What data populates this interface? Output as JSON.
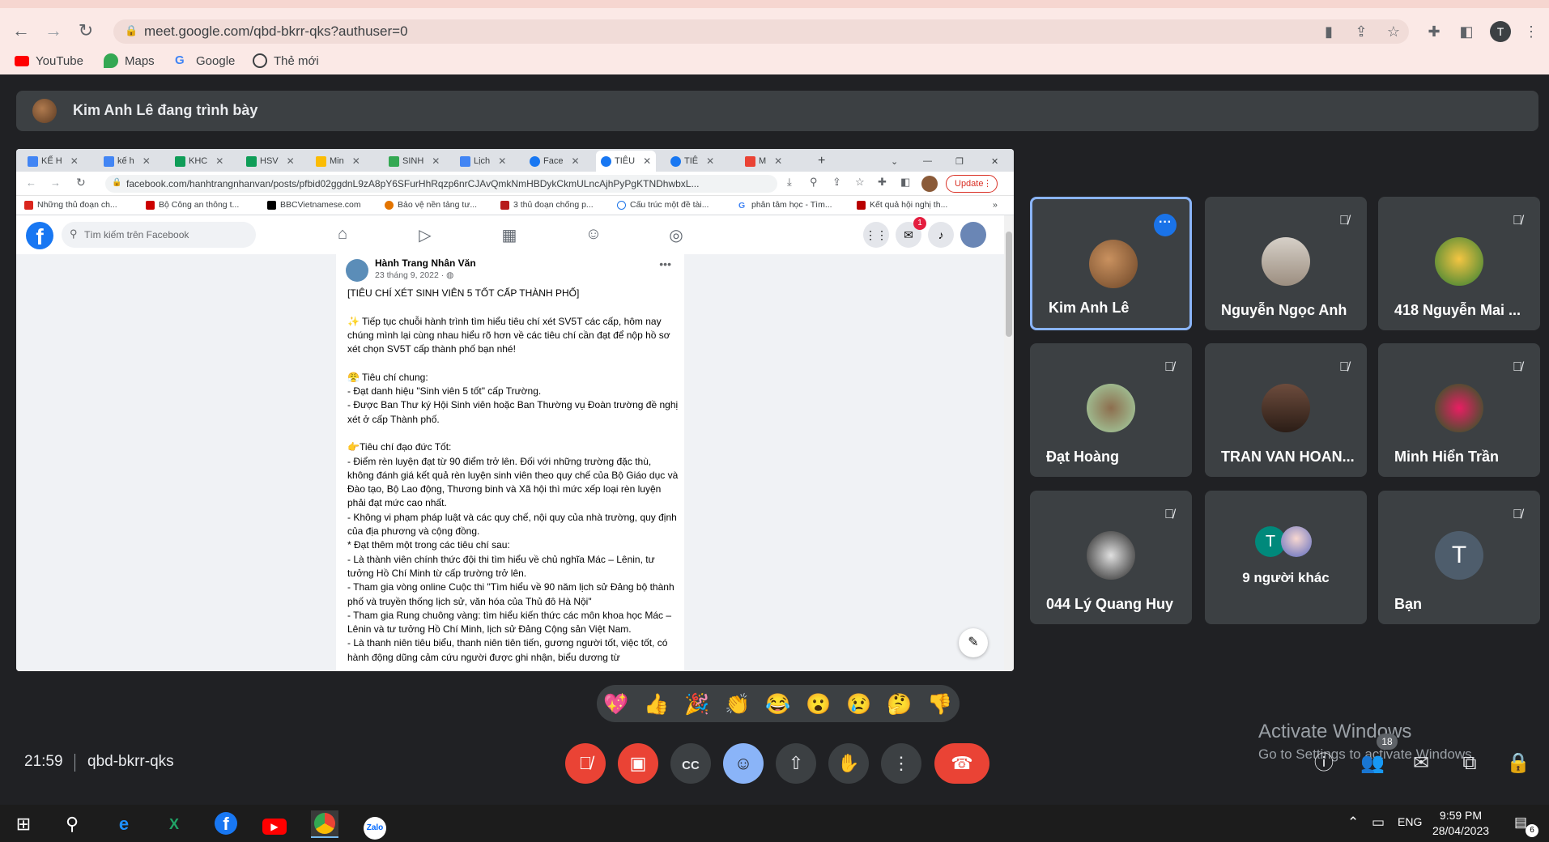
{
  "browser": {
    "url": "meet.google.com/qbd-bkrr-qks?authuser=0",
    "profile_initial": "T",
    "bookmarks": [
      "YouTube",
      "Maps",
      "Google",
      "Thẻ mới"
    ]
  },
  "presenting": {
    "text": "Kim Anh Lê đang trình bày"
  },
  "shared_screen": {
    "tabs": [
      "KẾ H",
      "kế h",
      "KHC",
      "HSV",
      "Min",
      "SINH",
      "Lịch",
      "Face",
      "TIÊU",
      "TIÊ",
      "M"
    ],
    "url": "facebook.com/hanhtrangnhanvan/posts/pfbid02ggdnL9zA8pY6SFurHhRqzp6nrCJAvQmkNmHBDykCkmULncAjhPyPgKTNDhwbxL...",
    "update_label": "Update",
    "bookmarks": [
      "Những thủ đoạn ch...",
      "Bộ Công an thông t...",
      "BBCVietnamese.com",
      "Bảo vệ nền tảng tư...",
      "3 thủ đoạn chống p...",
      "Cấu trúc một đề tài...",
      "phân tâm học - Tìm...",
      "Kết quả hội nghị th..."
    ],
    "fb_search_placeholder": "Tìm kiếm trên Facebook",
    "notification_count": "1",
    "post": {
      "author": "Hành Trang Nhân Văn",
      "date": "23 tháng 9, 2022 · ",
      "text": "[TIÊU CHÍ XÉT SINH VIÊN 5 TỐT CẤP THÀNH PHỐ]\n\n✨ Tiếp tục chuỗi hành trình tìm hiểu tiêu chí xét SV5T các cấp, hôm nay chúng mình lại cùng nhau hiểu rõ hơn về các tiêu chí cần đạt để nộp hồ sơ xét chọn SV5T cấp thành phố bạn nhé!\n\n😤 Tiêu chí chung:\n- Đạt danh hiệu \"Sinh viên 5 tốt\" cấp Trường.\n- Được Ban Thư ký Hội Sinh viên hoặc Ban Thường vụ Đoàn trường đề nghị xét ở cấp Thành phố.\n\n👉Tiêu chí đạo đức Tốt:\n- Điểm rèn luyện đạt từ 90 điểm trở lên. Đối với những trường đặc thù, không đánh giá kết quả rèn luyện sinh viên theo quy chế của Bộ Giáo dục và Đào tạo, Bộ Lao động, Thương binh và Xã hội thì mức xếp loại rèn luyện phải đạt mức cao nhất.\n- Không vi phạm pháp luật và các quy chế, nội quy của nhà trường, quy định của địa phương và cộng đồng.\n* Đạt thêm một trong các tiêu chí sau:\n- Là thành viên chính thức đội thi tìm hiểu về chủ nghĩa Mác – Lênin, tư tưởng Hồ Chí Minh từ cấp trường trở lên.\n- Tham gia vòng online Cuộc thi \"Tìm hiểu về 90 năm lịch sử Đảng bộ thành phố và truyền thống lịch sử, văn hóa của Thủ đô Hà Nội\"\n- Tham gia Rung chuông vàng: tìm hiểu kiến thức các môn khoa học Mác – Lênin và tư tưởng Hồ Chí Minh, lịch sử Đảng Cộng sản Việt Nam.\n- Là thanh niên tiêu biểu, thanh niên tiên tiến, gương người tốt, việc tốt, có hành động dũng cảm cứu người được ghi nhận, biểu dương từ"
    }
  },
  "participants": [
    {
      "name": "Kim Anh Lê",
      "speaking": true,
      "muted": false
    },
    {
      "name": "Nguyễn Ngọc Anh",
      "muted": true
    },
    {
      "name": "418 Nguyễn Mai ...",
      "muted": true
    },
    {
      "name": "Đạt Hoàng",
      "muted": true
    },
    {
      "name": "TRAN VAN HOAN...",
      "muted": true
    },
    {
      "name": "Minh Hiển Trần",
      "muted": true
    },
    {
      "name": "044 Lý Quang Huy",
      "muted": true
    },
    {
      "name": "9 người khác",
      "initial": "T"
    },
    {
      "name": "Bạn",
      "initial": "T",
      "muted": true
    }
  ],
  "reactions": [
    "💖",
    "👍",
    "🎉",
    "👏",
    "😂",
    "😮",
    "😢",
    "🤔",
    "👎"
  ],
  "meeting": {
    "time": "21:59",
    "code": "qbd-bkrr-qks",
    "participant_count": "18"
  },
  "watermark": {
    "line1": "Activate Windows",
    "line2": "Go to Settings to activate Windows."
  },
  "taskbar": {
    "lang": "ENG",
    "time": "9:59 PM",
    "date": "28/04/2023",
    "notif_count": "6"
  },
  "colors": {
    "accent": "#8ab4f8",
    "danger": "#ea4335",
    "bg": "#202124",
    "tile": "#3c4043"
  }
}
